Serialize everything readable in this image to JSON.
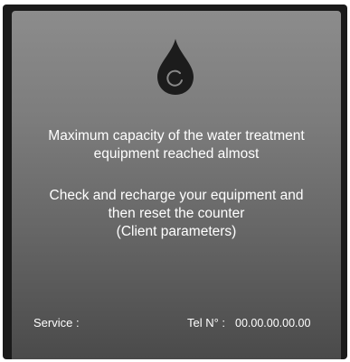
{
  "icon": "water-drop-refresh-icon",
  "colors": {
    "icon": "#1c1c1c",
    "text": "#ffffff",
    "panel_top": "#8c8c8c",
    "panel_bottom": "#4a4a4a",
    "frame": "#1a1a1a"
  },
  "alert": {
    "message_1": [
      "Maximum capacity of the water treatment",
      "equipment reached almost"
    ],
    "message_2": [
      "Check and recharge your equipment and",
      "then reset the counter",
      "(Client parameters)"
    ]
  },
  "footer": {
    "service_label": "Service :",
    "tel_label": "Tel N° :",
    "tel_value": "00.00.00.00.00"
  }
}
